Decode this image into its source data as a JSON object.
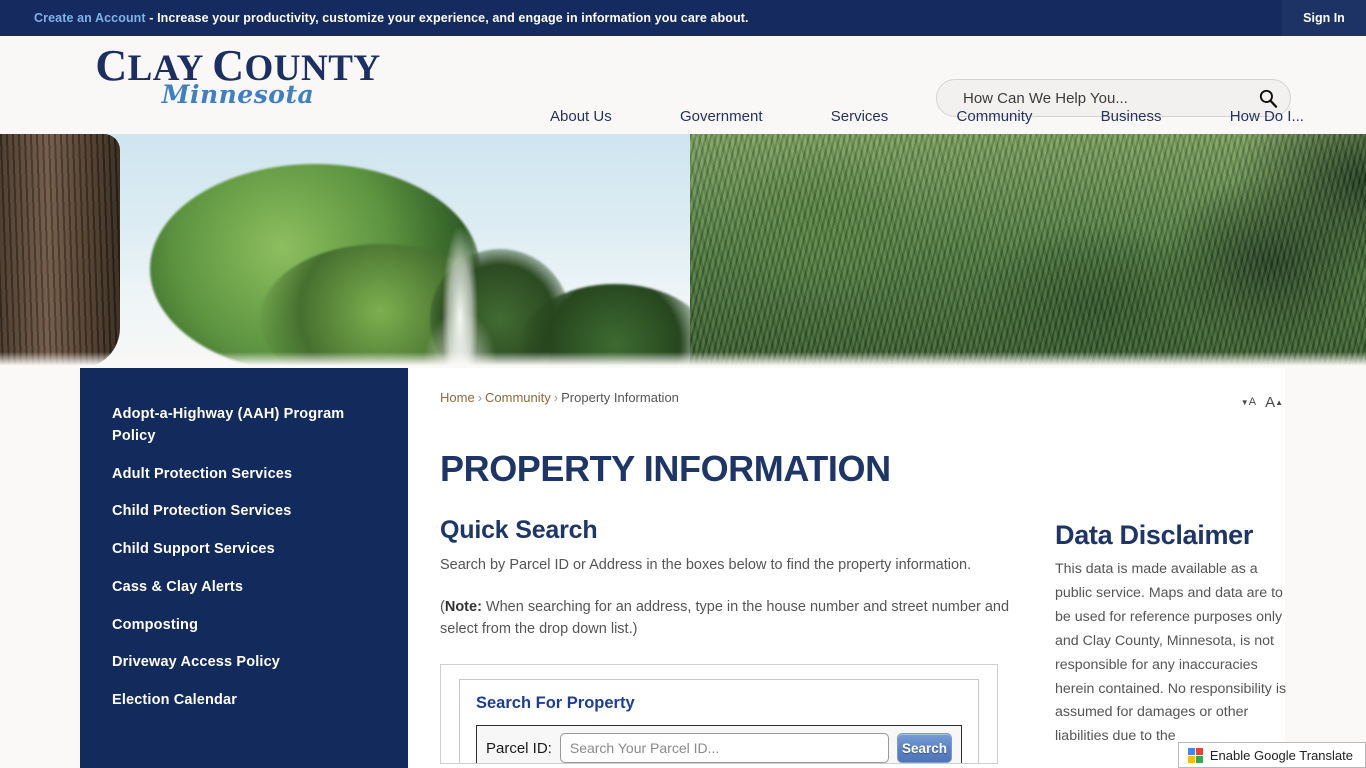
{
  "account_bar": {
    "create_link": "Create an Account",
    "message": " - Increase your productivity, customize your experience, and engage in information you care about.",
    "sign_in": "Sign In"
  },
  "header": {
    "logo_line1": "C",
    "logo_line1_rest": "LAY ",
    "logo_line1_c2": "C",
    "logo_line1_rest2": "OUNTY",
    "logo_line2": "Minnesota",
    "search_placeholder": "How Can We Help You...",
    "search_value": ""
  },
  "nav": {
    "items": [
      {
        "label": "About Us"
      },
      {
        "label": "Government"
      },
      {
        "label": "Services"
      },
      {
        "label": "Community"
      },
      {
        "label": "Business"
      },
      {
        "label": "How Do I..."
      }
    ]
  },
  "sidebar": {
    "items": [
      {
        "label": "Adopt-a-Highway (AAH) Program Policy"
      },
      {
        "label": "Adult Protection Services"
      },
      {
        "label": "Child Protection Services"
      },
      {
        "label": "Child Support Services"
      },
      {
        "label": "Cass & Clay Alerts"
      },
      {
        "label": "Composting"
      },
      {
        "label": "Driveway Access Policy"
      },
      {
        "label": "Election Calendar"
      }
    ]
  },
  "breadcrumb": {
    "home": "Home",
    "sep": "›",
    "parent": "Community",
    "current": "Property Information"
  },
  "font_tools": {
    "decrease": "A",
    "increase": "A",
    "decrease_caret": "▼",
    "increase_caret": "▲"
  },
  "main": {
    "page_title": "PROPERTY INFORMATION",
    "quick_search_heading": "Quick Search",
    "quick_search_text": "Search by Parcel ID or Address in the boxes below to find the property information.",
    "note_prefix": "(",
    "note_label": "Note:",
    "note_text": "  When searching for an address, type in the house number and street number and select from the drop down list.)"
  },
  "search_panel": {
    "title": "Search For Property",
    "parcel_label": "Parcel ID:",
    "parcel_placeholder": "Search Your Parcel ID...",
    "parcel_value": "",
    "search_button": "Search"
  },
  "disclaimer": {
    "title": "Data Disclaimer",
    "body": "This data is made available as a public service. Maps and data are to be used for reference purposes only and Clay County, Minnesota, is not responsible for any inaccuracies herein contained. No responsibility is assumed for damages or other liabilities due to the"
  },
  "translate": {
    "label": "Enable Google Translate"
  },
  "colors": {
    "navy": "#132a5c",
    "top_bar": "#152a5e",
    "link_blue": "#7fb3e8",
    "heading_navy": "#1e3567",
    "panel_blue": "#1c3f94",
    "button_blue": "#5b82c4",
    "breadcrumb_brown": "#8a6a3e"
  }
}
